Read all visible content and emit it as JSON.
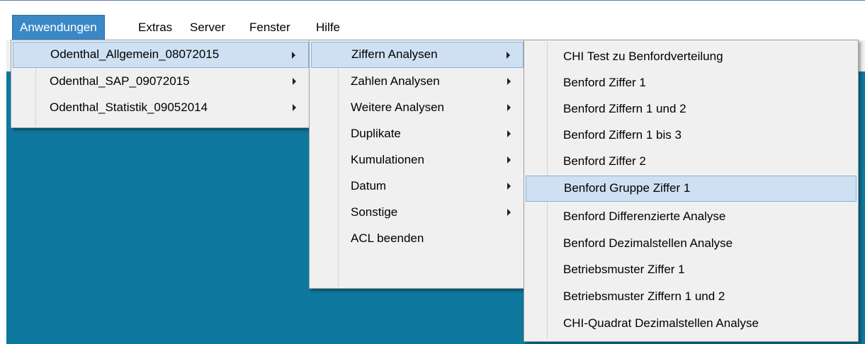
{
  "menubar": {
    "items": [
      {
        "label": "Anwendungen"
      },
      {
        "label": "Extras"
      },
      {
        "label": "Server"
      },
      {
        "label": "Fenster"
      },
      {
        "label": "Hilfe"
      }
    ]
  },
  "menu_level1": {
    "items": [
      {
        "label": "Odenthal_Allgemein_08072015"
      },
      {
        "label": "Odenthal_SAP_09072015"
      },
      {
        "label": "Odenthal_Statistik_09052014"
      }
    ]
  },
  "menu_level2": {
    "items": [
      {
        "label": "Ziffern Analysen"
      },
      {
        "label": "Zahlen Analysen"
      },
      {
        "label": "Weitere Analysen"
      },
      {
        "label": "Duplikate"
      },
      {
        "label": "Kumulationen"
      },
      {
        "label": "Datum"
      },
      {
        "label": "Sonstige"
      },
      {
        "label": "ACL beenden"
      }
    ]
  },
  "menu_level3": {
    "items": [
      {
        "label": "CHI Test zu Benfordverteilung"
      },
      {
        "label": "Benford Ziffer 1"
      },
      {
        "label": "Benford Ziffern 1 und 2"
      },
      {
        "label": "Benford Ziffern 1 bis 3"
      },
      {
        "label": "Benford Ziffer 2"
      },
      {
        "label": "Benford Gruppe Ziffer 1"
      },
      {
        "label": "Benford Differenzierte Analyse"
      },
      {
        "label": "Benford Dezimalstellen Analyse"
      },
      {
        "label": "Betriebsmuster Ziffer 1"
      },
      {
        "label": "Betriebsmuster Ziffern 1 und 2"
      },
      {
        "label": "CHI-Quadrat Dezimalstellen Analyse"
      }
    ]
  },
  "colors": {
    "menubar_active": "#3b88c6",
    "menu_highlight": "#cfe0f2",
    "client_area": "#0e789e"
  }
}
